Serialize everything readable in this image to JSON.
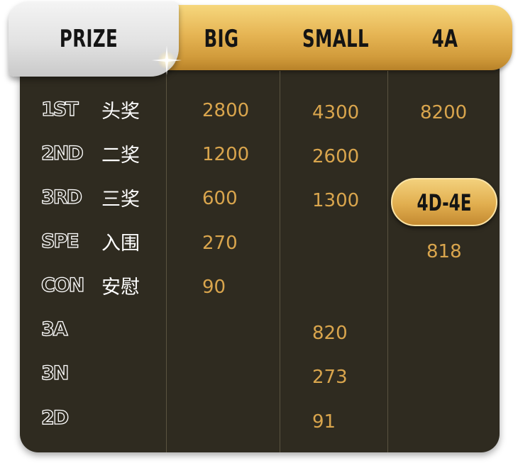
{
  "header": {
    "prize_label": "PRIZE",
    "columns": [
      "BIG",
      "SMALL",
      "4A"
    ]
  },
  "rows": [
    {
      "code": "1ST",
      "cn": "头奖"
    },
    {
      "code": "2ND",
      "cn": "二奖"
    },
    {
      "code": "3RD",
      "cn": "三奖"
    },
    {
      "code": "SPE",
      "cn": "入围"
    },
    {
      "code": "CON",
      "cn": "安慰"
    },
    {
      "code": "3A",
      "cn": ""
    },
    {
      "code": "3N",
      "cn": ""
    },
    {
      "code": "2D",
      "cn": ""
    }
  ],
  "big": [
    "2800",
    "1200",
    "600",
    "270",
    "90"
  ],
  "small": [
    "4300",
    "2600",
    "1300",
    "820",
    "273",
    "91"
  ],
  "four_a": {
    "first": "8200",
    "subhead": "4D-4E",
    "subvalue": "818"
  },
  "colors": {
    "panel": "#2f2b20",
    "gold": "#e6b554",
    "value_text": "#d9a54d",
    "silver": "#e2e2e2"
  }
}
